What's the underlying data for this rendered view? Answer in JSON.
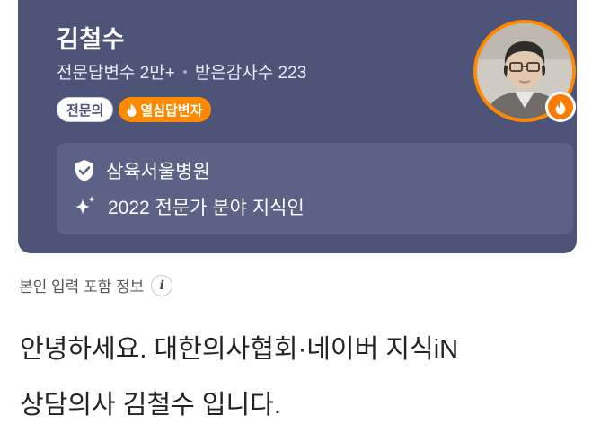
{
  "profile": {
    "name": "김철수",
    "answers_label": "전문답변수 2만+",
    "thanks_label": "받은감사수 223",
    "badges": {
      "expert": "전문의",
      "hot": "열심답변자"
    },
    "avatar_icon": "doctor-portrait",
    "hospital": "삼육서울병원",
    "award": "2022 전문가 분야 지식인"
  },
  "self_info": {
    "label": "본인 입력 포함 정보",
    "icon": "info-icon"
  },
  "intro": {
    "line1": "안녕하세요. 대한의사협회·네이버 지식iN",
    "line2": "상담의사 김철수 입니다."
  },
  "colors": {
    "card_bg": "#4e5478",
    "accent_orange": "#ff8a00"
  }
}
